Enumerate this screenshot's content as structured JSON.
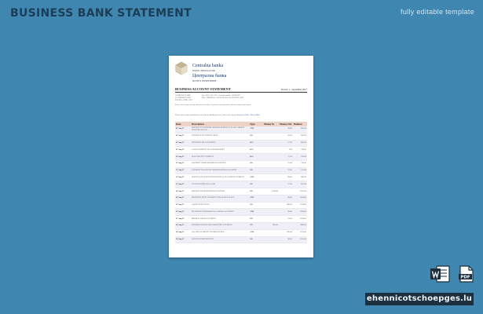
{
  "header": {
    "title": "BUSINESS BANK STATEMENT",
    "subtitle": "fully editable template"
  },
  "document": {
    "bank_name_latin": "Centralna banka",
    "bank_subtitle_latin": "BOSNE I HERCEGOVINE",
    "bank_name_cyrillic": "Централна банка",
    "bank_subtitle_cyrillic": "БОСНЕ И ХЕРЦЕГОВИНЕ",
    "statement_title": "BUSINESS ACCOUNT STATEMENT",
    "statement_date": "Period: 1 - September 2017",
    "info_left": [
      "COMPANY NAME",
      "10 ADDRESS LINE",
      "POSTAL CODE CITY"
    ],
    "info_right": [
      "Ref: 0123 / 45 / 678 - Account number 123456789",
      "BIC: CBBHBA22 - IBAN BA39 1234 5678 9012 3456"
    ],
    "note": "Please check your account statement carefully. If you have any questions, please contact your branch.",
    "note2_text": "Please check your transactions at our internet banking service, where you can get ",
    "note2_link": "Statement Order / Direct Mails",
    "columns": [
      "Date",
      "Description",
      "Type",
      "Money In",
      "Money Out",
      "Balance"
    ],
    "rows": [
      [
        "01 Aug 17",
        "DEPOSIT CASH FROM ABROAD SERVICE SALARY ARBEIT ELEKTRO FOCUS",
        "ATM",
        "",
        "98.00",
        "801.00"
      ],
      [
        "02 Aug 17",
        "INTERNAL TRANSFER FROM",
        "DD",
        "",
        "20.00",
        "801.00"
      ],
      [
        "05 Aug 17",
        "INTERNET BILL PAYMENT",
        "BGC",
        "",
        "17.50",
        "803.00"
      ],
      [
        "07 Aug 17",
        "CARD PAYMENT TO SUPERMARKET",
        "BGC",
        "",
        "7.80",
        "790.00"
      ],
      [
        "10 Aug 17",
        "ELECTRICITY PAYMENT",
        "BGC",
        "",
        "17.50",
        "750.00"
      ],
      [
        "12 Aug 17",
        "PAYMENT FROM BUSINESS PARTNER",
        "DD",
        "",
        "25.00",
        "730.00"
      ],
      [
        "13 Aug 17",
        "PAYMENT TRANSFER FROM BUSINESS ACCOUNT",
        "DD",
        "",
        "12.00",
        "701.00"
      ],
      [
        "14 Aug 17",
        "SERVICE FEE FOR INTERNATIONAL TRANSFER PAYMENT",
        "ATM",
        "",
        "98.00",
        "690.00"
      ],
      [
        "15 Aug 17",
        "CASH WITHDRAWAL ATM",
        "DD",
        "",
        "17.50",
        "672.00"
      ],
      [
        "18 Aug 17",
        "DEPOSIT FROM BUSINESS PARTNER",
        "DD",
        "1240.00",
        "",
        "1912.00"
      ],
      [
        "20 Aug 17",
        "MONTHLY RENT PAYMENT FOR OFFICE SPACE",
        "ATM",
        "",
        "98.00",
        "1814.00"
      ],
      [
        "22 Aug 17",
        "GOODS PURCHASE",
        "DD",
        "",
        "480.00",
        "1334.00"
      ],
      [
        "23 Aug 17",
        "TRANSFER TO PERSONAL SAVINGS ACCOUNT",
        "ATM",
        "",
        "98.00",
        "1236.00"
      ],
      [
        "25 Aug 17",
        "MOBILE PHONE PAYMENT",
        "DD",
        "",
        "12.00",
        "1224.00"
      ],
      [
        "26 Aug 17",
        "BUSINESS INSURANCE MONTHLY PAYMENT",
        "DD",
        "685.00",
        "",
        "1909.00"
      ],
      [
        "28 Aug 17",
        "SALARY PAYMENT TO EMPLOYEES",
        "ATM",
        "",
        "790.00",
        "1119.00"
      ],
      [
        "30 Aug 17",
        "ONLINE SUBSCRIPTION",
        "DD",
        "",
        "98.00",
        "1021.00"
      ]
    ]
  },
  "icons": {
    "word": "word-document-icon",
    "pdf": "pdf-document-icon",
    "pdf_label": "PDF"
  },
  "footer": {
    "site": "ehennicotschoepges.lu"
  },
  "colors": {
    "background": "#3f86b0",
    "title": "#1c3d55",
    "table_header": "#eed3c6",
    "banner": "#1b2f3e"
  }
}
